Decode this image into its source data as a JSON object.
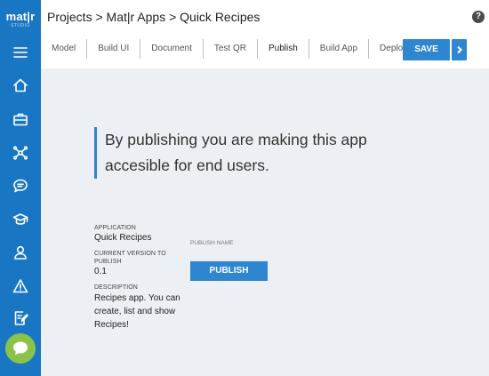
{
  "sidebar": {
    "logo": "mat|r",
    "logo_sub": "STUDIO",
    "items": [
      {
        "icon": "menu-icon"
      },
      {
        "icon": "home-icon"
      },
      {
        "icon": "briefcase-icon"
      },
      {
        "icon": "network-icon"
      },
      {
        "icon": "chat-icon"
      },
      {
        "icon": "graduation-cap-icon"
      },
      {
        "icon": "user-icon"
      },
      {
        "icon": "warning-icon"
      },
      {
        "icon": "document-edit-icon"
      }
    ],
    "chat_widget_color": "#8bc34a"
  },
  "header": {
    "breadcrumb": "Projects > Mat|r Apps > Quick Recipes",
    "help": "?"
  },
  "tabs": [
    {
      "label": "Model"
    },
    {
      "label": "Build UI"
    },
    {
      "label": "Document"
    },
    {
      "label": "Test QR"
    },
    {
      "label": "Publish",
      "active": true
    },
    {
      "label": "Build App"
    },
    {
      "label": "Deploy"
    }
  ],
  "toolbar": {
    "save_label": "SAVE"
  },
  "main": {
    "headline": "By publishing you are making this app accesible for end users.",
    "application_label": "APPLICATION",
    "application_value": "Quick Recipes",
    "version_label": "CURRENT VERSION TO PUBLISH",
    "version_value": "0.1",
    "description_label": "DESCRIPTION",
    "description_value": "Recipes app. You can create, list and show Recipes!",
    "publish_name_label": "PUBLISH NAME",
    "publish_name_value": "",
    "publish_button": "PUBLISH"
  },
  "colors": {
    "sidebar": "#1976c2",
    "accent": "#2f86d0",
    "content_bg": "#eceff3"
  }
}
